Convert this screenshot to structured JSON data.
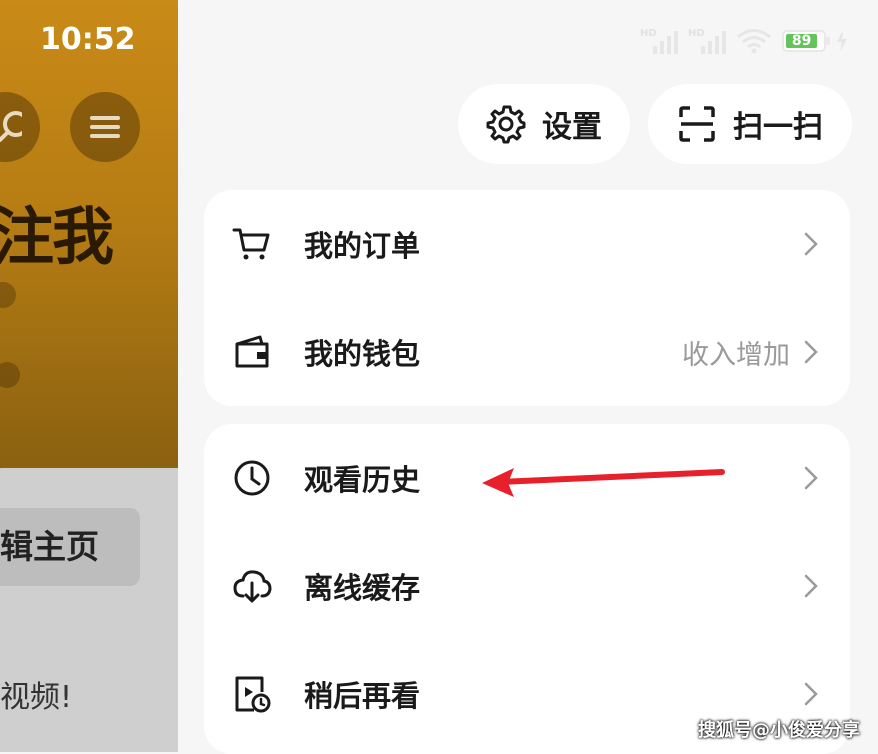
{
  "background": {
    "time": "10:52",
    "headline": "注我",
    "button_text": "辑主页",
    "caption": "视频!"
  },
  "status": {
    "battery": "89"
  },
  "top_actions": {
    "settings_label": "设置",
    "scan_label": "扫一扫"
  },
  "menu_group_1": [
    {
      "label": "我的订单",
      "extra": ""
    },
    {
      "label": "我的钱包",
      "extra": "收入增加"
    }
  ],
  "menu_group_2": [
    {
      "label": "观看历史",
      "extra": ""
    },
    {
      "label": "离线缓存",
      "extra": ""
    },
    {
      "label": "稍后再看",
      "extra": ""
    }
  ],
  "watermark": "搜狐号@小俊爱分享",
  "colors": {
    "arrow": "#e8202c",
    "battery": "#64c45b",
    "background_panel": "#c98a16"
  },
  "icons": [
    "cart-icon",
    "wallet-icon",
    "clock-icon",
    "cloud-download-icon",
    "watch-later-icon",
    "gear-icon",
    "scan-icon",
    "chevron-right-icon"
  ]
}
